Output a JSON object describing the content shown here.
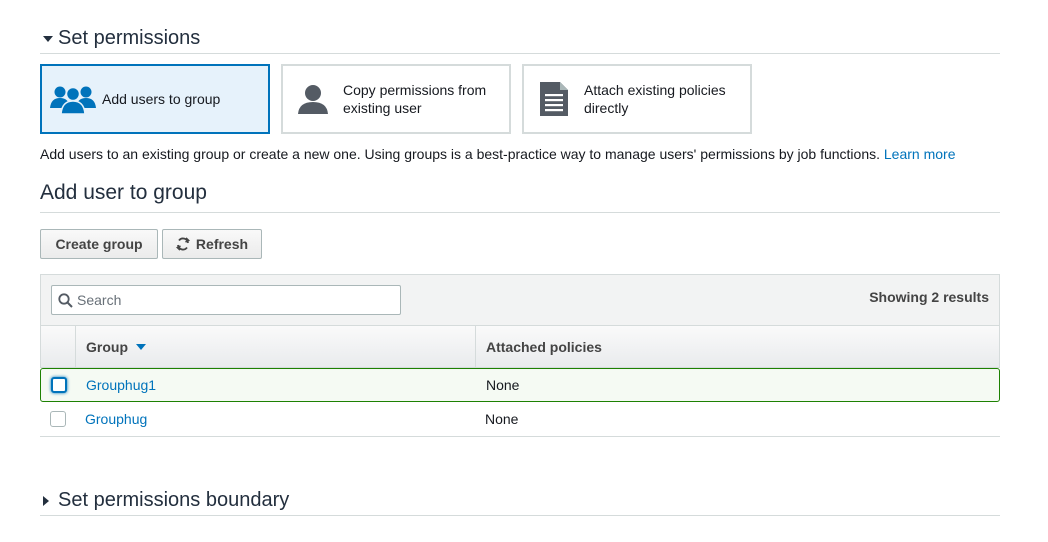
{
  "set_permissions": {
    "title": "Set permissions"
  },
  "options": [
    {
      "label": "Add users to group",
      "icon": "users-group-icon",
      "selected": true
    },
    {
      "label": "Copy permissions from existing user",
      "icon": "user-icon",
      "selected": false
    },
    {
      "label": "Attach existing policies directly",
      "icon": "document-icon",
      "selected": false
    }
  ],
  "description": {
    "text": "Add users to an existing group or create a new one. Using groups is a best-practice way to manage users' permissions by job functions.",
    "link": "Learn more"
  },
  "group_section": {
    "title": "Add user to group"
  },
  "toolbar": {
    "create_label": "Create group",
    "refresh_label": "Refresh"
  },
  "table": {
    "search_placeholder": "Search",
    "results_text": "Showing 2 results",
    "columns": {
      "group": "Group",
      "policies": "Attached policies"
    },
    "rows": [
      {
        "name": "Grouphug1",
        "policies": "None",
        "selected": true
      },
      {
        "name": "Grouphug",
        "policies": "None",
        "selected": false
      }
    ]
  },
  "boundary": {
    "title": "Set permissions boundary"
  },
  "colors": {
    "accent": "#0073bb",
    "selected_border": "#1d8102",
    "border": "#d5dbdb"
  }
}
